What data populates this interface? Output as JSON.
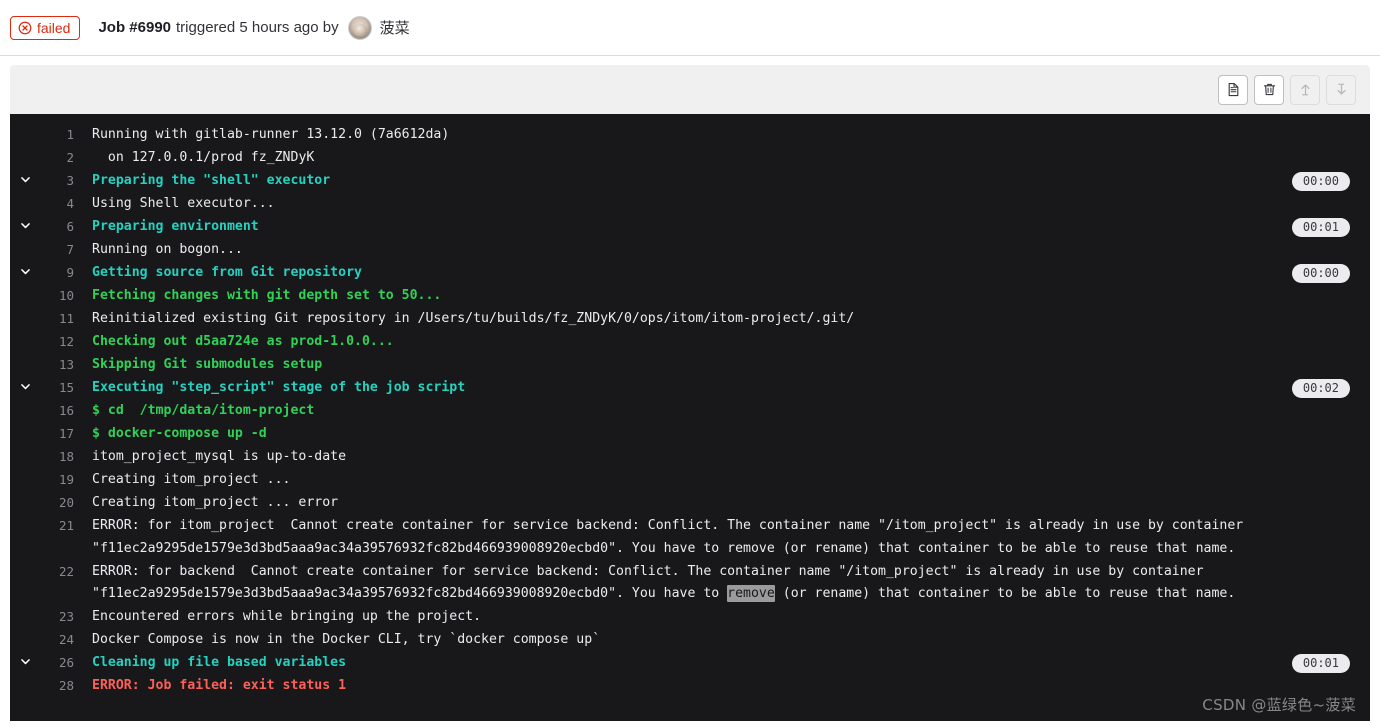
{
  "header": {
    "status_label": "failed",
    "status_icon": "circle-x-icon",
    "status_color": "#dd2b0e",
    "job_id": "Job #6990",
    "triggered_text": "triggered 5 hours ago by",
    "username": "菠菜"
  },
  "toolbar": {
    "buttons": [
      {
        "name": "raw-log-button",
        "icon": "file-document-icon",
        "disabled": false
      },
      {
        "name": "erase-log-button",
        "icon": "trash-icon",
        "disabled": false
      },
      {
        "name": "scroll-top-button",
        "icon": "arrow-up-icon",
        "disabled": true
      },
      {
        "name": "scroll-bottom-button",
        "icon": "arrow-down-icon",
        "disabled": true
      }
    ]
  },
  "log": {
    "background": "#18181b",
    "lines": [
      {
        "num": "1",
        "collapsible": false,
        "color": "white",
        "text": "Running with gitlab-runner 13.12.0 (7a6612da)",
        "duration": ""
      },
      {
        "num": "2",
        "collapsible": false,
        "color": "white",
        "text": "  on 127.0.0.1/prod fz_ZNDyK",
        "duration": ""
      },
      {
        "num": "3",
        "collapsible": true,
        "color": "teal",
        "text": "Preparing the \"shell\" executor",
        "duration": "00:00"
      },
      {
        "num": "4",
        "collapsible": false,
        "color": "white",
        "text": "Using Shell executor...",
        "duration": ""
      },
      {
        "num": "6",
        "collapsible": true,
        "color": "teal",
        "text": "Preparing environment",
        "duration": "00:01"
      },
      {
        "num": "7",
        "collapsible": false,
        "color": "white",
        "text": "Running on bogon...",
        "duration": ""
      },
      {
        "num": "9",
        "collapsible": true,
        "color": "teal",
        "text": "Getting source from Git repository",
        "duration": "00:00"
      },
      {
        "num": "10",
        "collapsible": false,
        "color": "green",
        "text": "Fetching changes with git depth set to 50...",
        "duration": ""
      },
      {
        "num": "11",
        "collapsible": false,
        "color": "white",
        "text": "Reinitialized existing Git repository in /Users/tu/builds/fz_ZNDyK/0/ops/itom/itom-project/.git/",
        "duration": ""
      },
      {
        "num": "12",
        "collapsible": false,
        "color": "green",
        "text": "Checking out d5aa724e as prod-1.0.0...",
        "duration": ""
      },
      {
        "num": "13",
        "collapsible": false,
        "color": "green",
        "text": "Skipping Git submodules setup",
        "duration": ""
      },
      {
        "num": "15",
        "collapsible": true,
        "color": "teal",
        "text": "Executing \"step_script\" stage of the job script",
        "duration": "00:02"
      },
      {
        "num": "16",
        "collapsible": false,
        "color": "green",
        "text": "$ cd  /tmp/data/itom-project",
        "duration": ""
      },
      {
        "num": "17",
        "collapsible": false,
        "color": "green",
        "text": "$ docker-compose up -d",
        "duration": ""
      },
      {
        "num": "18",
        "collapsible": false,
        "color": "white",
        "text": "itom_project_mysql is up-to-date",
        "duration": ""
      },
      {
        "num": "19",
        "collapsible": false,
        "color": "white",
        "text": "Creating itom_project ...",
        "duration": ""
      },
      {
        "num": "20",
        "collapsible": false,
        "color": "white",
        "text": "Creating itom_project ... error",
        "duration": ""
      },
      {
        "num": "21",
        "collapsible": false,
        "color": "white",
        "text": "ERROR: for itom_project  Cannot create container for service backend: Conflict. The container name \"/itom_project\" is already in use by container \"f11ec2a9295de1579e3d3bd5aaa9ac34a39576932fc82bd466939008920ecbd0\". You have to remove (or rename) that container to be able to reuse that name.",
        "duration": ""
      },
      {
        "num": "22",
        "collapsible": false,
        "color": "white",
        "highlight": "remove",
        "text_before": "ERROR: for backend  Cannot create container for service backend: Conflict. The container name \"/itom_project\" is already in use by container \"f11ec2a9295de1579e3d3bd5aaa9ac34a39576932fc82bd466939008920ecbd0\". You have to ",
        "text_after": " (or rename) that container to be able to reuse that name.",
        "text": "ERROR: for backend  Cannot create container for service backend: Conflict. The container name \"/itom_project\" is already in use by container \"f11ec2a9295de1579e3d3bd5aaa9ac34a39576932fc82bd466939008920ecbd0\". You have to remove (or rename) that container to be able to reuse that name.",
        "duration": ""
      },
      {
        "num": "23",
        "collapsible": false,
        "color": "white",
        "text": "Encountered errors while bringing up the project.",
        "duration": ""
      },
      {
        "num": "24",
        "collapsible": false,
        "color": "white",
        "text": "Docker Compose is now in the Docker CLI, try `docker compose up`",
        "duration": ""
      },
      {
        "num": "26",
        "collapsible": true,
        "color": "teal",
        "text": "Cleaning up file based variables",
        "duration": "00:01"
      },
      {
        "num": "28",
        "collapsible": false,
        "color": "red",
        "text": "ERROR: Job failed: exit status 1",
        "duration": ""
      }
    ]
  },
  "watermark": "CSDN @蓝绿色~菠菜"
}
